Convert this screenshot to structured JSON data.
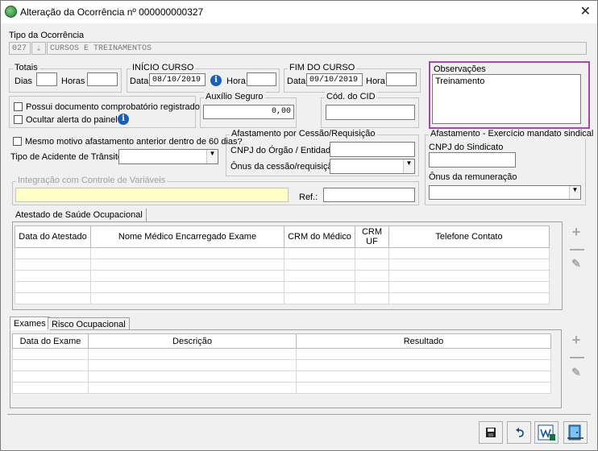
{
  "window": {
    "title": "Alteração da Ocorrência nº 000000000327"
  },
  "tipo": {
    "label": "Tipo da Ocorrência",
    "code": "027",
    "description": "CURSOS E TREINAMENTOS"
  },
  "totais": {
    "legend": "Totais",
    "dias_label": "Dias",
    "horas_label": "Horas",
    "dias": "",
    "horas": ""
  },
  "inicio": {
    "legend": "INÍCIO CURSO",
    "data_label": "Data",
    "data": "08/10/2019",
    "hora_label": "Hora",
    "hora": ""
  },
  "fim": {
    "legend": "FIM DO CURSO",
    "data_label": "Data",
    "data": "09/10/2019",
    "hora_label": "Hora",
    "hora": ""
  },
  "observacoes": {
    "legend": "Observações",
    "text": "Treinamento"
  },
  "checks": {
    "possui": "Possui documento comprobatório registrado",
    "ocultar": "Ocultar alerta do painel",
    "mesmo_motivo": "Mesmo motivo afastamento anterior dentro de 60 dias?"
  },
  "auxilio": {
    "legend": "Auxílio Seguro",
    "value": "0,00"
  },
  "cid": {
    "legend": "Cód. do CID",
    "value": ""
  },
  "acidente": {
    "label": "Tipo de Acidente de Trânsito:",
    "value": ""
  },
  "cessao": {
    "legend": "Afastamento por Cessão/Requisição",
    "cnpj_label": "CNPJ do Órgão / Entidade:",
    "onus_label": "Ônus da cessão/requisição:"
  },
  "sindical": {
    "legend": "Afastamento - Exercício mandato sindical",
    "cnpj_label": "CNPJ do Sindicato",
    "onus_label": "Ônus da remuneração"
  },
  "integracao": {
    "legend": "Integração com Controle de Variáveis",
    "ref_label": "Ref.:"
  },
  "atestado": {
    "tab": "Atestado de Saúde Ocupacional",
    "columns": [
      "Data do Atestado",
      "Nome Médico Encarregado Exame",
      "CRM do Médico",
      "CRM UF",
      "Telefone Contato"
    ]
  },
  "exames": {
    "tabs": [
      "Exames",
      "Risco Ocupacional"
    ],
    "columns": [
      "Data do Exame",
      "Descrição",
      "Resultado"
    ]
  },
  "icons": {
    "add": "plus-icon",
    "remove": "minus-icon",
    "edit": "pencil-icon"
  }
}
